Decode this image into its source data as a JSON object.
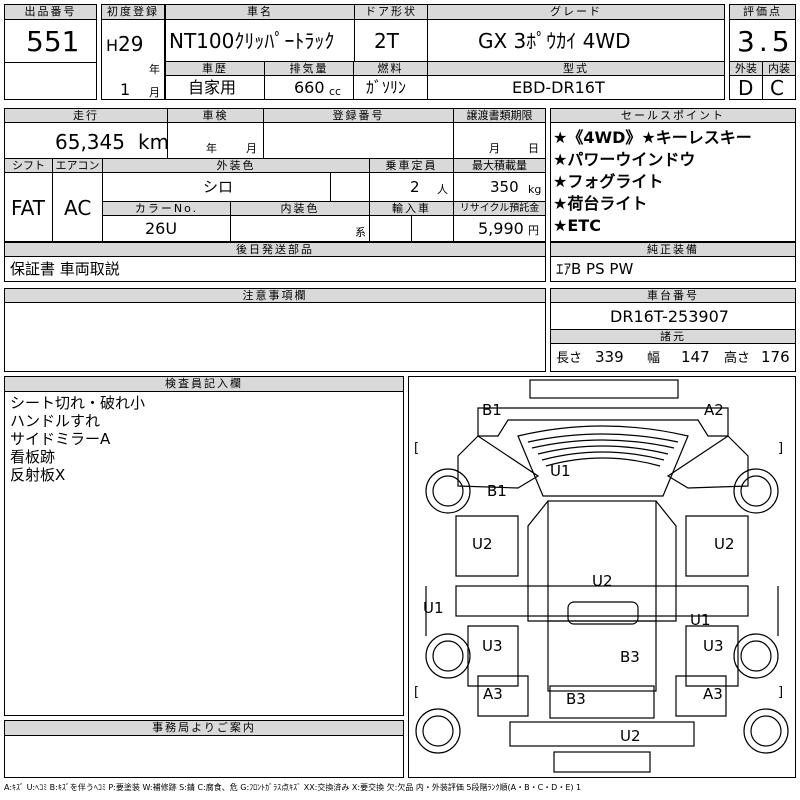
{
  "header": {
    "lot_label": "出品番号",
    "lot_no": "551",
    "first_reg_label": "初度登録",
    "era": "H",
    "reg_year": "29",
    "year_unit": "年",
    "reg_month": "1",
    "month_unit": "月",
    "car_name_label": "車名",
    "car_name": "NT100ｸﾘｯﾊﾟｰﾄﾗｯｸ",
    "door_label": "ドア形状",
    "door": "2T",
    "grade_label": "グレード",
    "grade": "GX 3ﾎﾟｳｶｲ 4WD",
    "score_label": "評価点",
    "score": "3.5",
    "history_label": "車歴",
    "history": "自家用",
    "displacement_label": "排気量",
    "displacement": "660",
    "displacement_unit": "cc",
    "fuel_label": "燃料",
    "fuel": "ｶﾞｿﾘﾝ",
    "model_label": "型式",
    "model": "EBD-DR16T",
    "exterior_label": "外装",
    "exterior": "D",
    "interior_label": "内装",
    "interior": "C"
  },
  "specs": {
    "mileage_label": "走行",
    "mileage": "65,345",
    "mileage_unit": "km",
    "inspection_label": "車検",
    "year_unit": "年",
    "month_unit": "月",
    "reg_no_label": "登録番号",
    "transfer_label": "譲渡書類期限",
    "transfer_month": "月",
    "transfer_day": "日",
    "shift_label": "シフト",
    "shift": "FAT",
    "ac_label": "エアコン",
    "ac": "AC",
    "color_label": "外装色",
    "color": "シロ",
    "capacity_label": "乗車定員",
    "capacity": "2",
    "capacity_unit": "人",
    "max_load_label": "最大積載量",
    "max_load": "350",
    "max_load_unit": "kg",
    "color_no_label": "カラーNo.",
    "color_no": "26U",
    "int_color_label": "内装色",
    "int_color_unit": "系",
    "import_label": "輸入車",
    "recycle_label": "リサイクル預託金",
    "recycle": "5,990",
    "recycle_unit": "円",
    "later_parts_label": "後日発送部品",
    "later_parts": "保証書 車両取説"
  },
  "sales": {
    "label": "セールスポイント",
    "points": [
      "★《4WD》★キーレスキー",
      "★パワーウインドウ",
      "★フォグライト",
      "★荷台ライト",
      "★ETC"
    ]
  },
  "equipment": {
    "label": "純正装備",
    "value": "ｴｱB PS PW"
  },
  "notes": {
    "label": "注意事項欄"
  },
  "chassis": {
    "label": "車台番号",
    "value": "DR16T-253907"
  },
  "dims": {
    "label": "諸元",
    "length_label": "長さ",
    "length": "339",
    "width_label": "幅",
    "width": "147",
    "height_label": "高さ",
    "height": "176"
  },
  "inspector": {
    "label": "検査員記入欄",
    "lines": [
      "シート切れ・破れ小",
      "ハンドルすれ",
      "サイドミラーA",
      "看板跡",
      "反射板X"
    ]
  },
  "office": {
    "label": "事務局よりご案内"
  },
  "diagram": {
    "marks": [
      "B1",
      "A2",
      "U1",
      "B1",
      "U2",
      "U2",
      "U2",
      "U2",
      "U1",
      "U1",
      "U3",
      "U3",
      "B3",
      "A3",
      "A3",
      "B3",
      "U2"
    ],
    "bracket_open": "[",
    "bracket_close": "]"
  },
  "legend": "A:ｷｽﾞ U:ﾍｺﾐ B:ｷｽﾞを伴うﾍｺﾐ P:要塗装 W:補修跡 S:錆 C:腐食、危 G:ﾌﾛﾝﾄｶﾞﾗｽ点ｷｽﾞ XX:交換済み X:要交換 欠:欠品 内・外装評価 5段階ﾗﾝｸ順(A・B・C・D・E) 1"
}
